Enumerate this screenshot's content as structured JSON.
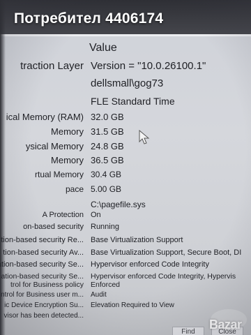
{
  "overlay_title": "Потребител 4406174",
  "table": {
    "value_header": "Value",
    "rows": [
      {
        "item": "traction Layer",
        "value": "Version = \"10.0.26100.1\""
      },
      {
        "item": "",
        "value": "dellsmall\\gog73"
      },
      {
        "item": "",
        "value": "FLE Standard Time"
      },
      {
        "item": "ical Memory (RAM)",
        "value": "32.0 GB"
      },
      {
        "item": "Memory",
        "value": "31.5 GB"
      },
      {
        "item": "ysical Memory",
        "value": "24.8 GB"
      },
      {
        "item": "Memory",
        "value": "36.5 GB"
      },
      {
        "item": "rtual Memory",
        "value": "30.4 GB"
      },
      {
        "item": "pace",
        "value": "5.00 GB"
      },
      {
        "item": "",
        "value": "C:\\pagefile.sys"
      },
      {
        "item": "A Protection",
        "value": "On"
      },
      {
        "item": "on-based security",
        "value": "Running"
      },
      {
        "item": "tion-based security Re...",
        "value": "Base Virtualization Support"
      },
      {
        "item": "tion-based security Av...",
        "value": "Base Virtualization Support, Secure Boot, DI"
      },
      {
        "item": "ation-based security Se...",
        "value": "Hypervisor enforced Code Integrity"
      },
      {
        "item": "ation-based security Se...",
        "value": "Hypervisor enforced Code Integrity, Hypervis"
      },
      {
        "item": "trol for Business policy",
        "value": "Enforced"
      },
      {
        "item": "ntrol for Business user m...",
        "value": "Audit"
      },
      {
        "item": "ic Device Encryption Su...",
        "value": "Elevation Required to View"
      },
      {
        "item": "visor has been detected...",
        "value": ""
      }
    ]
  },
  "buttons": {
    "find": "Find",
    "close": "Close"
  },
  "watermark": "Bazar",
  "colors": {
    "text": "#1e1f24",
    "background": "#d5d7dc",
    "top_bezel": "#2e2f35"
  }
}
